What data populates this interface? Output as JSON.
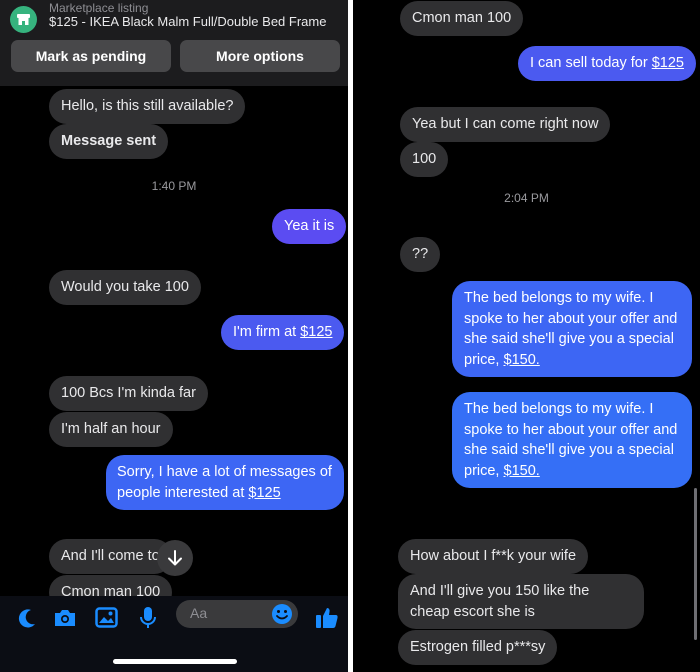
{
  "left": {
    "listing": {
      "label": "Marketplace listing",
      "item": "$125 - IKEA Black Malm Full/Double Bed Frame",
      "pending_label": "Mark as pending",
      "more_label": "More options"
    },
    "messages": {
      "m1": "Hello, is this still available?",
      "m2": "Message sent",
      "ts1": "1:40 PM",
      "m3": "Yea it is",
      "m4": "Would you take 100",
      "m5a": "I'm firm at ",
      "m5b": "$125",
      "m6": "100 Bcs I'm kinda far",
      "m7": "I'm half an hour",
      "m8a": "Sorry, I have a lot of messages of people interested at ",
      "m8b": "$125",
      "m9": "And I'll come to",
      "m10": "Cmon man 100"
    },
    "composer": {
      "placeholder": "Aa"
    }
  },
  "right": {
    "messages": {
      "m1": "Cmon man 100",
      "m2a": "I can sell today for ",
      "m2b": "$125",
      "m3": "Yea but I can come right now",
      "m4": "100",
      "ts1": "2:04 PM",
      "m5": "??",
      "m6a": "The bed belongs to my wife. I spoke to her about your offer and she said she'll give you a special price, ",
      "m6b": "$150.",
      "m7a": "The bed belongs to my wife. I spoke to her about your offer and she said she'll give you a special price, ",
      "m7b": "$150.",
      "m8": "How about I f**k your wife",
      "m9": "And I'll give you 150 like the cheap escort she is",
      "m10": "Estrogen filled p***sy"
    }
  },
  "colors": {
    "background": "#000000",
    "incoming_bubble": "#303032",
    "outgoing_bubble_top": "#5b4cf2",
    "outgoing_bubble_bottom": "#356ff6",
    "marketplace_green": "#36b37e",
    "composer_icon": "#1a8cff"
  }
}
